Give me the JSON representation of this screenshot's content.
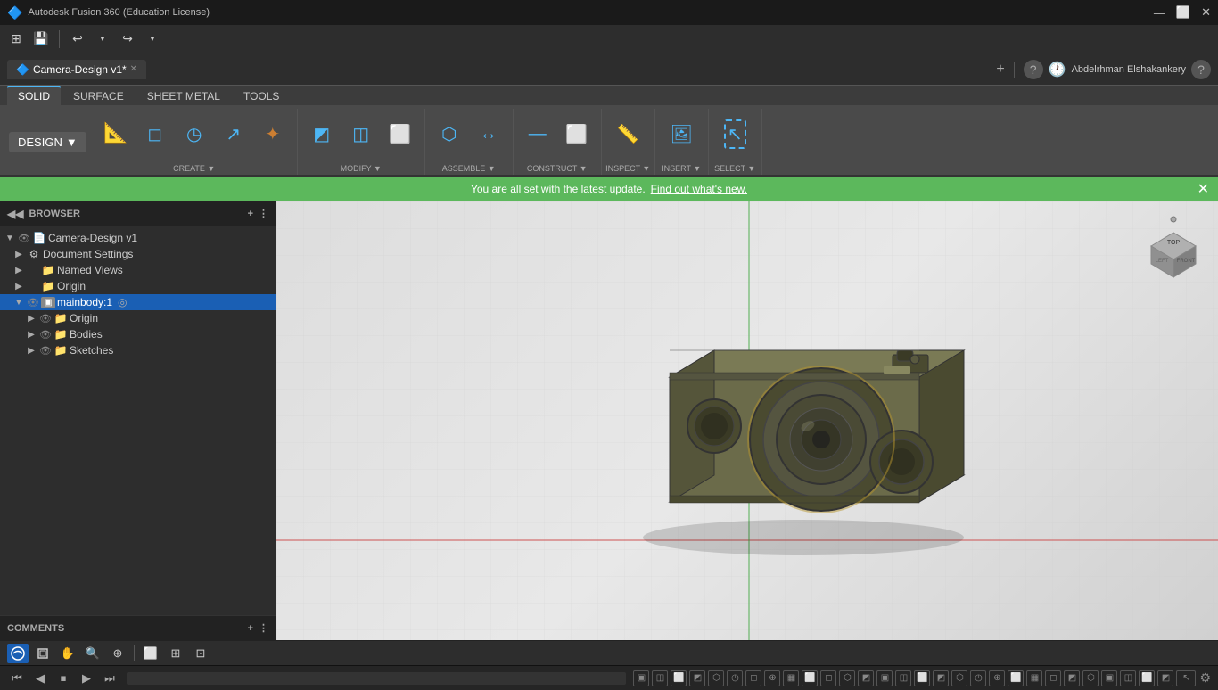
{
  "app": {
    "title": "Autodesk Fusion 360 (Education License)",
    "icon": "🔷"
  },
  "titlebar": {
    "title": "Autodesk Fusion 360 (Education License)",
    "minimize": "—",
    "maximize": "⬜",
    "close": "✕"
  },
  "toolbar": {
    "grid_btn": "⊞",
    "save_btn": "💾",
    "undo_btn": "↩",
    "redo_btn": "↪"
  },
  "tabs": [
    {
      "label": "Camera-Design v1*",
      "active": true,
      "icon": "🔷"
    }
  ],
  "tab_controls": {
    "add": "+",
    "help": "?",
    "time": "🕐",
    "user": "Abdelrhman Elshakankery"
  },
  "ribbon": {
    "tabs": [
      "SOLID",
      "SURFACE",
      "SHEET METAL",
      "TOOLS"
    ],
    "active_tab": "SOLID",
    "design_label": "DESIGN",
    "groups": [
      {
        "name": "CREATE",
        "buttons": [
          {
            "icon": "⊞",
            "label": ""
          },
          {
            "icon": "◻",
            "label": ""
          },
          {
            "icon": "◷",
            "label": ""
          },
          {
            "icon": "⬡",
            "label": ""
          },
          {
            "icon": "✦",
            "label": ""
          }
        ]
      },
      {
        "name": "MODIFY",
        "buttons": [
          {
            "icon": "◩",
            "label": ""
          },
          {
            "icon": "◫",
            "label": ""
          },
          {
            "icon": "⬜",
            "label": ""
          }
        ]
      },
      {
        "name": "ASSEMBLE",
        "buttons": [
          {
            "icon": "⬡",
            "label": ""
          },
          {
            "icon": "↔",
            "label": ""
          }
        ]
      },
      {
        "name": "CONSTRUCT",
        "buttons": [
          {
            "icon": "—",
            "label": ""
          },
          {
            "icon": "⬜",
            "label": ""
          }
        ]
      },
      {
        "name": "INSPECT",
        "buttons": [
          {
            "icon": "📐",
            "label": ""
          }
        ]
      },
      {
        "name": "INSERT",
        "buttons": [
          {
            "icon": "🖼",
            "label": ""
          }
        ]
      },
      {
        "name": "SELECT",
        "buttons": [
          {
            "icon": "↖",
            "label": ""
          }
        ]
      }
    ]
  },
  "notification": {
    "text": "You are all set with the latest update.",
    "link_text": "Find out what's new.",
    "close": "✕"
  },
  "browser": {
    "title": "BROWSER",
    "collapse_btn": "◀",
    "splitter": "⋮",
    "tree": [
      {
        "indent": 0,
        "arrow": "▼",
        "eye": true,
        "icon": "📄",
        "label": "Camera-Design v1",
        "tag": ""
      },
      {
        "indent": 1,
        "arrow": "▶",
        "eye": false,
        "icon": "⚙",
        "label": "Document Settings",
        "tag": ""
      },
      {
        "indent": 1,
        "arrow": "▶",
        "eye": false,
        "icon": "📁",
        "label": "Named Views",
        "tag": ""
      },
      {
        "indent": 1,
        "arrow": "▶",
        "eye": false,
        "icon": "📁",
        "label": "Origin",
        "tag": ""
      },
      {
        "indent": 1,
        "arrow": "▼",
        "eye": true,
        "icon": "📦",
        "label": "mainbody:1",
        "selected": true,
        "tag": "◎"
      },
      {
        "indent": 2,
        "arrow": "▶",
        "eye": true,
        "icon": "📁",
        "label": "Origin",
        "tag": ""
      },
      {
        "indent": 2,
        "arrow": "▶",
        "eye": true,
        "icon": "📁",
        "label": "Bodies",
        "tag": ""
      },
      {
        "indent": 2,
        "arrow": "▶",
        "eye": true,
        "icon": "📁",
        "label": "Sketches",
        "tag": ""
      }
    ]
  },
  "comments": {
    "title": "COMMENTS",
    "add_btn": "+",
    "splitter": "⋮"
  },
  "bottom_toolbar": {
    "buttons": [
      {
        "icon": "⊕",
        "active": true,
        "label": "orbit"
      },
      {
        "icon": "⊡",
        "label": "home"
      },
      {
        "icon": "✋",
        "label": "pan"
      },
      {
        "icon": "🔍",
        "label": "zoom"
      },
      {
        "icon": "⊕",
        "label": "zoom-fit"
      }
    ],
    "view_buttons": [
      {
        "icon": "⬜",
        "label": "view-1"
      },
      {
        "icon": "⊞",
        "label": "view-2"
      },
      {
        "icon": "⊡",
        "label": "view-3"
      }
    ]
  },
  "anim_bar": {
    "buttons_left": [
      "⏮",
      "◀",
      "⏹",
      "▶",
      "⏭"
    ],
    "icons": [
      "⬜",
      "⬜",
      "⬜",
      "⬜",
      "⬜",
      "⬜",
      "⬜",
      "⬜",
      "⬜",
      "⬜",
      "⬜",
      "⬜",
      "⬜",
      "⬜",
      "⬜",
      "⬜",
      "⬜",
      "⬜",
      "⬜",
      "⬜",
      "⬜",
      "⬜",
      "⬜",
      "⬜",
      "⬜",
      "⬜",
      "⬜",
      "⬜",
      "⬜",
      "⬜"
    ],
    "gear": "⚙"
  },
  "viewport": {
    "background": "#e0e0e0"
  }
}
